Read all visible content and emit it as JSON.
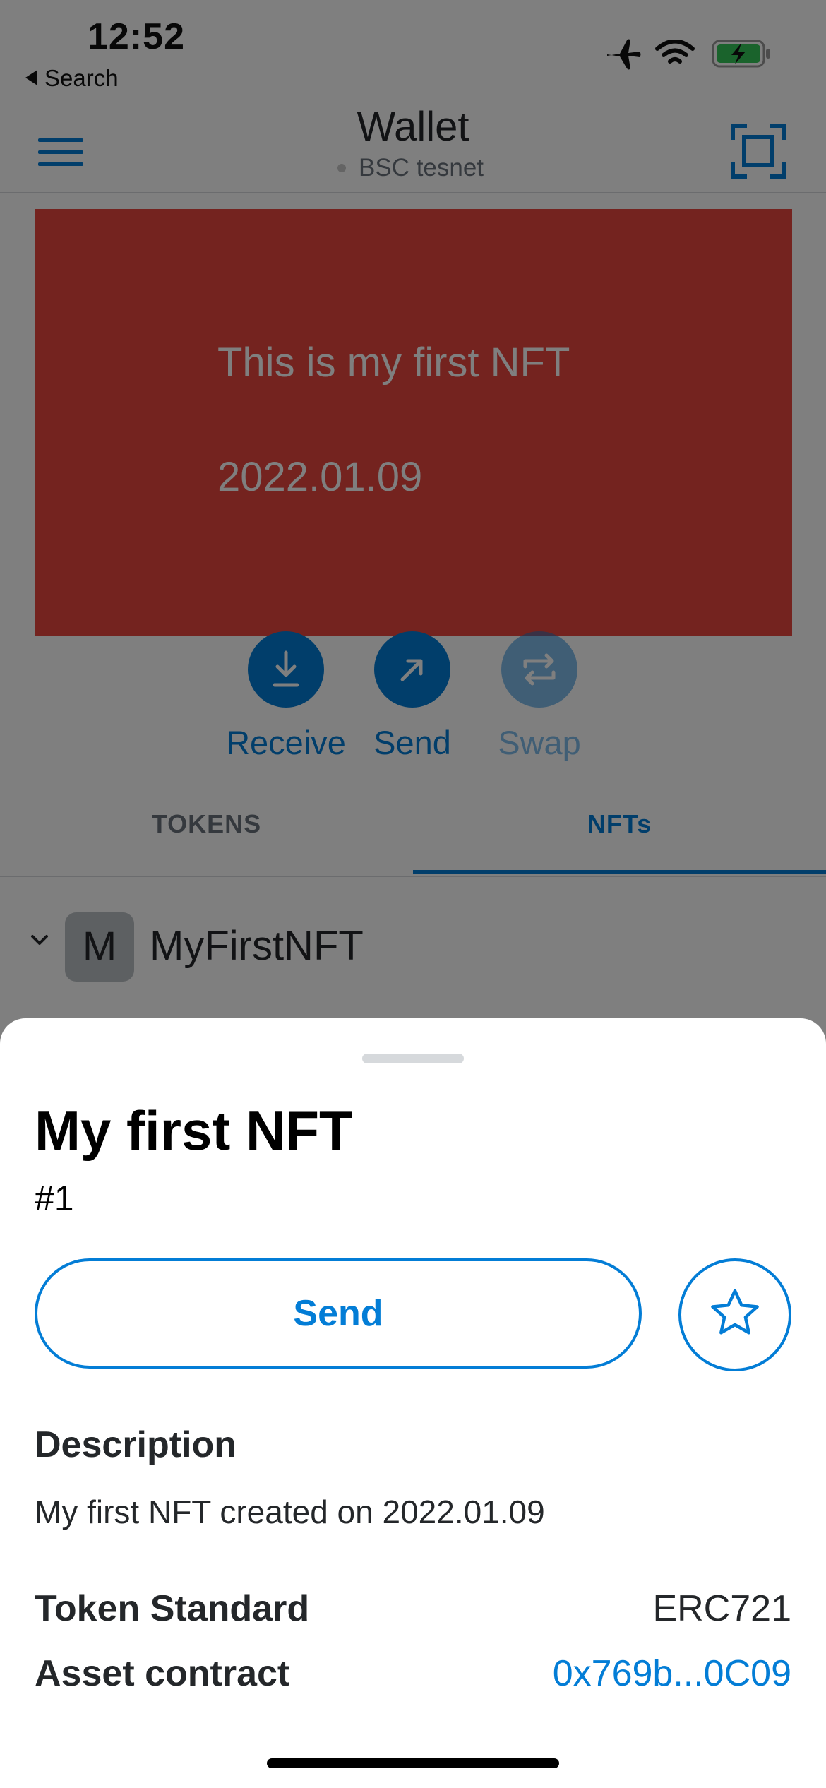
{
  "status_bar": {
    "time": "12:52",
    "back_label": "Search"
  },
  "header": {
    "title": "Wallet",
    "network": "BSC tesnet"
  },
  "nft_image": {
    "line1": "This is my first NFT",
    "line2": "2022.01.09",
    "background": "#e8473f"
  },
  "actions": [
    {
      "label": "Receive",
      "icon": "download-icon"
    },
    {
      "label": "Send",
      "icon": "arrow-up-right-icon"
    },
    {
      "label": "Swap",
      "icon": "swap-icon"
    }
  ],
  "tabs": [
    {
      "label": "TOKENS",
      "active": false
    },
    {
      "label": "NFTs",
      "active": true
    }
  ],
  "collection": {
    "avatar_letter": "M",
    "name": "MyFirstNFT"
  },
  "sheet": {
    "title": "My first NFT",
    "token_id": "#1",
    "send_label": "Send",
    "description_label": "Description",
    "description": "My first NFT created on 2022.01.09",
    "token_standard_label": "Token Standard",
    "token_standard": "ERC721",
    "asset_contract_label": "Asset contract",
    "asset_contract": "0x769b...0C09"
  },
  "colors": {
    "accent": "#037dd6",
    "text": "#24272a",
    "muted": "#6a737d"
  }
}
